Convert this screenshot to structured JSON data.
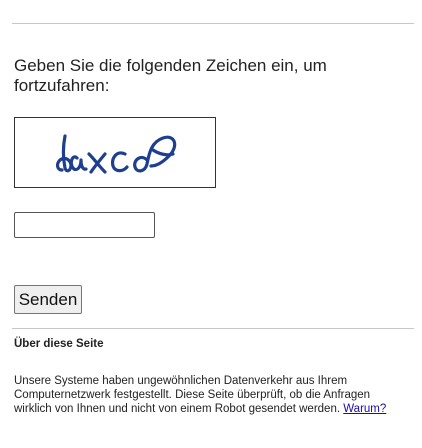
{
  "prompt": {
    "text": "Geben Sie die folgenden Zeichen ein, um fortzufahren:"
  },
  "captcha": {
    "image_icon": "distorted-captcha-characters",
    "ink_color": "#1e3f8f"
  },
  "form": {
    "input_value": "",
    "input_placeholder": "",
    "submit_label": "Senden"
  },
  "about": {
    "heading": "Über diese Seite",
    "body": "Unsere Systeme haben ungewöhnlichen Datenverkehr aus Ihrem Computernetzwerk festgestellt. Diese Seite überprüft, ob die Anfragen wirklich von Ihnen und nicht von einem Robot gesendet werden.",
    "link_label": "Warum?",
    "link_color": "#1a0dab"
  }
}
